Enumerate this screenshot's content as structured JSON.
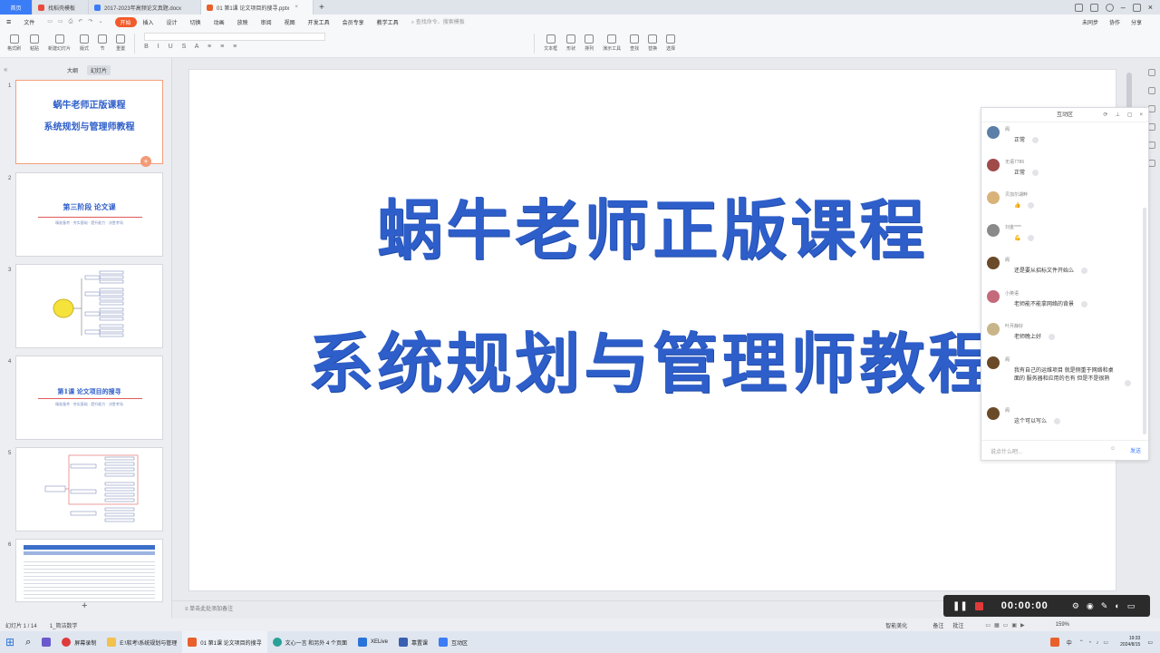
{
  "titlebar": {
    "tabs": [
      {
        "label": "首页",
        "kind": "home"
      },
      {
        "label": "找稻壳模板",
        "color": "#e84c3d"
      },
      {
        "label": "2017-2023年高频论文真题.docx",
        "color": "#3b7cf7"
      },
      {
        "label": "01 第1课 论文项目的搜寻.pptx",
        "color": "#e8602c",
        "active": true
      }
    ],
    "add": "+"
  },
  "menu": {
    "items": [
      "文件",
      "开始",
      "插入",
      "设计",
      "切换",
      "动画",
      "放映",
      "审阅",
      "视图",
      "开发工具",
      "会员专享",
      "教学工具"
    ],
    "selected": "开始",
    "search": "查找命令、搜索模板",
    "right": [
      "未同步",
      "协作",
      "分享"
    ]
  },
  "ribbon": {
    "groups": [
      "格式刷",
      "粘贴",
      "新建幻灯片",
      "版式",
      "节",
      "重置",
      "文本框",
      "形状",
      "排列",
      "演示工具",
      "查找",
      "替换",
      "选择"
    ]
  },
  "leftpane": {
    "tabs": [
      "大纲",
      "幻灯片"
    ],
    "active_tab": "幻灯片",
    "slides": [
      {
        "num": "1",
        "line1": "蜗牛老师正版课程",
        "line2": "系统规划与管理师教程"
      },
      {
        "num": "2",
        "line1": "第三阶段 论文课",
        "line2": "精准备考 · 夯实基础 · 提升能力 · 决胜考场"
      },
      {
        "num": "3",
        "line1": "",
        "line2": ""
      },
      {
        "num": "4",
        "line1": "第1课 论文项目的搜寻",
        "line2": "精准备考 · 夯实基础 · 提升能力 · 决胜考场"
      },
      {
        "num": "5",
        "line1": "",
        "line2": ""
      },
      {
        "num": "6",
        "line1": "",
        "line2": ""
      }
    ]
  },
  "slide": {
    "line1": "蜗牛老师正版课程",
    "line2": "系统规划与管理师教程"
  },
  "notes_placeholder": "单击此处添加备注",
  "status": {
    "slide_count": "幻灯片 1 / 14",
    "theme": "1_简洁数学",
    "right": [
      "智能美化",
      "备注",
      "批注"
    ],
    "zoom": "159%"
  },
  "chat": {
    "title": "互动区",
    "messages": [
      {
        "user": "阁",
        "text": "正常",
        "avatar_color": "#5b7fa6"
      },
      {
        "user": "无语7786",
        "text": "正常",
        "avatar_color": "#a04a4a"
      },
      {
        "user": "贝加尔湖畔",
        "text": "👍",
        "avatar_color": "#d9b27a"
      },
      {
        "user": "刘金****",
        "text": "💪",
        "avatar_color": "#8a8a8a"
      },
      {
        "user": "阁",
        "text": "还是要从招标文件开始么",
        "avatar_color": "#6b4a2a"
      },
      {
        "user": "小英语",
        "text": "老师能不能拿网络的背景",
        "avatar_color": "#c46a7a"
      },
      {
        "user": "叶月静好",
        "text": "老师晚上好",
        "avatar_color": "#c9b58a"
      },
      {
        "user": "阁",
        "text": "我有自己的运维项目 就是侧重于网络和桌面的 服务器和应用的也有 但是不是很熟",
        "avatar_color": "#6b4a2a"
      },
      {
        "user": "阁",
        "text": "这个可以写么",
        "avatar_color": "#6b4a2a"
      }
    ],
    "input_placeholder": "说点什么吧...",
    "send": "发送"
  },
  "recorder": {
    "time": "00:00:00"
  },
  "taskbar": {
    "items": [
      "屏幕录制",
      "E:\\软考\\系统规划与管理",
      "01 第1课 论文项目的搜寻",
      "文心一言 和另外 4 个页面",
      "XELive",
      "靠置课",
      "互动区"
    ],
    "time": "19:33",
    "date": "2024/8/15",
    "lang": "中"
  }
}
